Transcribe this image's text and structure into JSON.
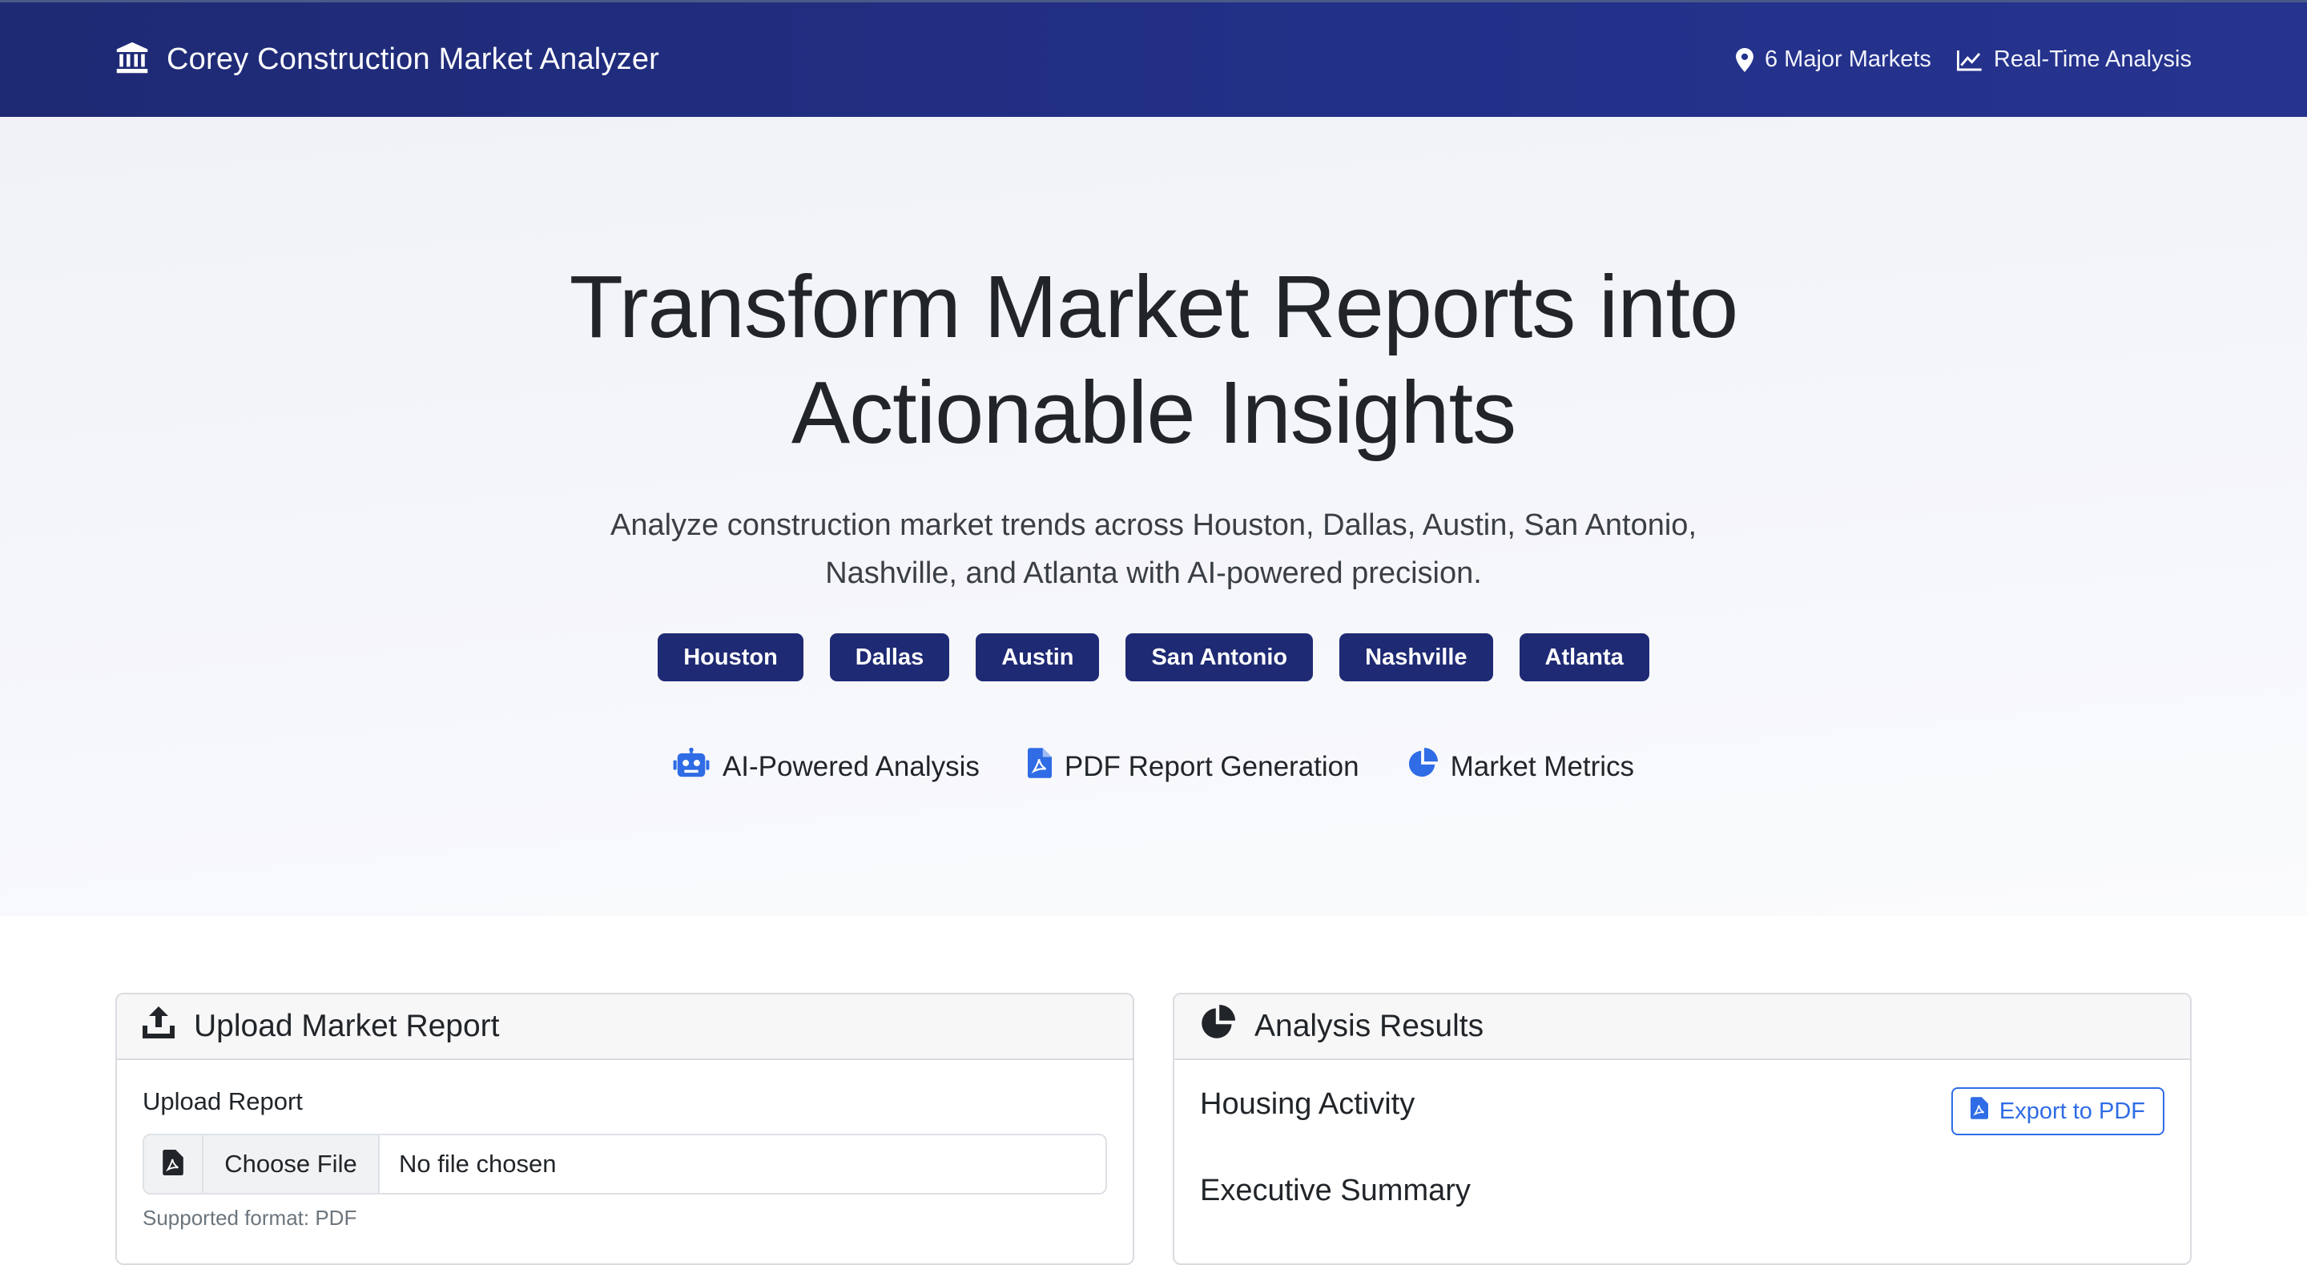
{
  "navbar": {
    "brand_icon": "bank-icon",
    "title": "Corey Construction Market Analyzer",
    "items": [
      {
        "icon": "map-pin-icon",
        "label": "6 Major Markets"
      },
      {
        "icon": "line-chart-icon",
        "label": "Real-Time Analysis"
      }
    ]
  },
  "hero": {
    "title_line1": "Transform Market Reports into",
    "title_line2": "Actionable Insights",
    "subtitle_line1": "Analyze construction market trends across Houston, Dallas, Austin, San Antonio,",
    "subtitle_line2": "Nashville, and Atlanta with AI-powered precision.",
    "markets": [
      "Houston",
      "Dallas",
      "Austin",
      "San Antonio",
      "Nashville",
      "Atlanta"
    ],
    "features": [
      {
        "icon": "robot-icon",
        "label": "AI-Powered Analysis"
      },
      {
        "icon": "file-pdf-icon",
        "label": "PDF Report Generation"
      },
      {
        "icon": "pie-chart-icon",
        "label": "Market Metrics"
      }
    ]
  },
  "upload_card": {
    "header_icon": "upload-icon",
    "title": "Upload Market Report",
    "field_label": "Upload Report",
    "file_icon": "file-pdf-icon",
    "choose_button": "Choose File",
    "file_status": "No file chosen",
    "help_text": "Supported format: PDF"
  },
  "results_card": {
    "header_icon": "pie-chart-icon",
    "title": "Analysis Results",
    "housing_title": "Housing Activity",
    "export_button": "Export to PDF",
    "executive_title": "Executive Summary"
  },
  "colors": {
    "navbar": "#1f2a74",
    "chip": "#1f2a74",
    "accent_blue": "#2f6ce5"
  }
}
